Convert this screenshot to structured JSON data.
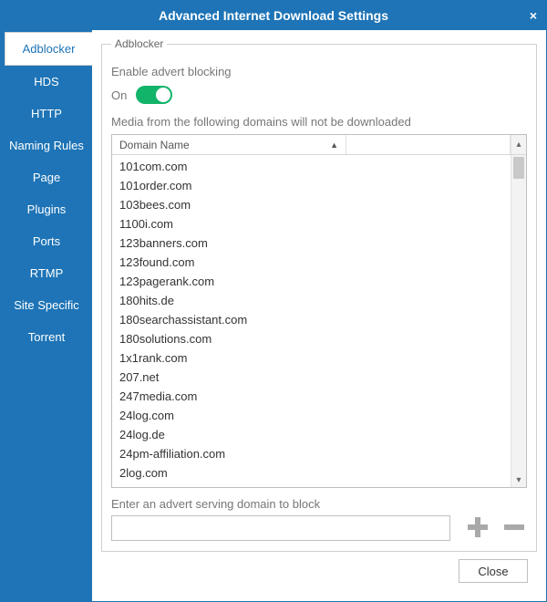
{
  "window": {
    "title": "Advanced Internet Download Settings",
    "close_icon": "×"
  },
  "sidebar": {
    "items": [
      {
        "label": "Adblocker",
        "active": true
      },
      {
        "label": "HDS",
        "active": false
      },
      {
        "label": "HTTP",
        "active": false
      },
      {
        "label": "Naming Rules",
        "active": false
      },
      {
        "label": "Page",
        "active": false
      },
      {
        "label": "Plugins",
        "active": false
      },
      {
        "label": "Ports",
        "active": false
      },
      {
        "label": "RTMP",
        "active": false
      },
      {
        "label": "Site Specific",
        "active": false
      },
      {
        "label": "Torrent",
        "active": false
      }
    ]
  },
  "panel": {
    "legend": "Adblocker",
    "enable_label": "Enable advert blocking",
    "toggle_state_label": "On",
    "list_hint": "Media from the following domains will not be downloaded",
    "column_header": "Domain Name",
    "domains": [
      "101com.com",
      "101order.com",
      "103bees.com",
      "1100i.com",
      "123banners.com",
      "123found.com",
      "123pagerank.com",
      "180hits.de",
      "180searchassistant.com",
      "180solutions.com",
      "1x1rank.com",
      "207.net",
      "247media.com",
      "24log.com",
      "24log.de",
      "24pm-affiliation.com",
      "2log.com"
    ],
    "input_label": "Enter an advert serving domain to block",
    "input_value": ""
  },
  "footer": {
    "close_label": "Close"
  }
}
